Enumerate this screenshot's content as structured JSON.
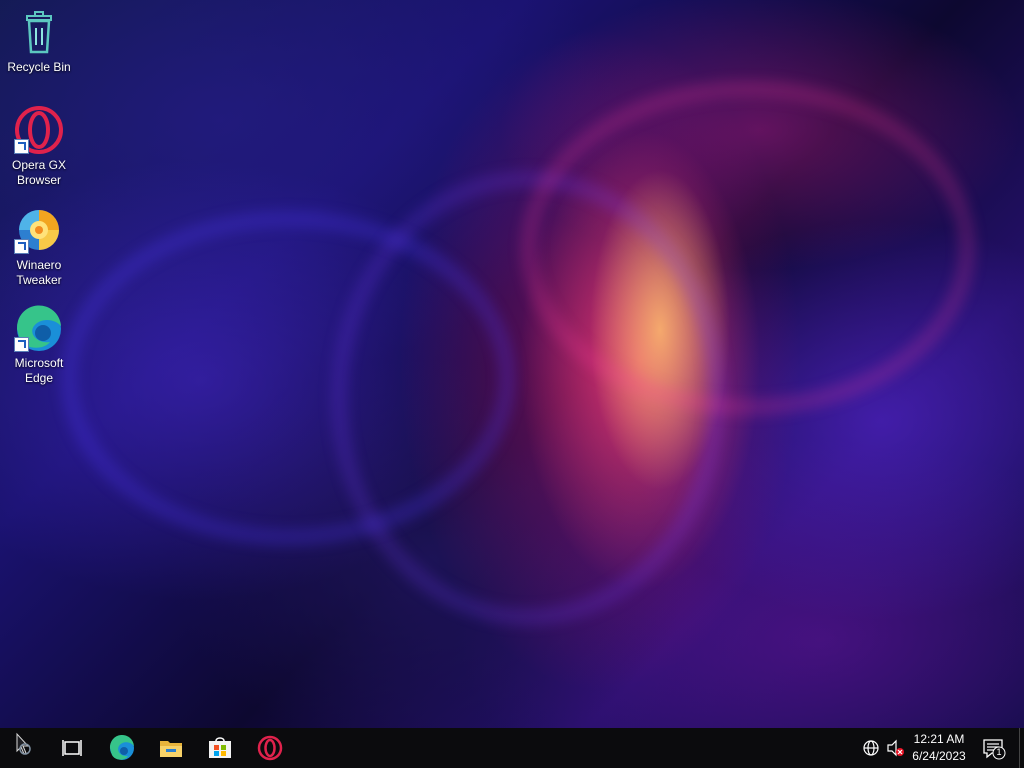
{
  "desktop": {
    "icons": [
      {
        "label_line1": "Recycle Bin",
        "label_line2": "",
        "icon": "recycle-bin-icon"
      },
      {
        "label_line1": "Opera GX",
        "label_line2": "Browser",
        "icon": "opera-gx-icon",
        "shortcut": true
      },
      {
        "label_line1": "Winaero",
        "label_line2": "Tweaker",
        "icon": "winaero-tweaker-icon",
        "shortcut": true
      },
      {
        "label_line1": "Microsoft",
        "label_line2": "Edge",
        "icon": "edge-icon",
        "shortcut": true
      }
    ]
  },
  "taskbar": {
    "pinned": [
      {
        "icon": "task-view-icon"
      },
      {
        "icon": "edge-icon"
      },
      {
        "icon": "file-explorer-icon"
      },
      {
        "icon": "microsoft-store-icon"
      },
      {
        "icon": "opera-icon"
      }
    ],
    "tray": {
      "network_icon": "globe-icon",
      "volume_icon": "speaker-muted-icon",
      "time": "12:21 AM",
      "date": "6/24/2023",
      "notifications_count": "1"
    }
  },
  "colors": {
    "taskbar_bg": "#0b0b0d",
    "accent_opera": "#e0224c",
    "edge_blue": "#1a8fd8",
    "edge_green": "#36c48a"
  }
}
